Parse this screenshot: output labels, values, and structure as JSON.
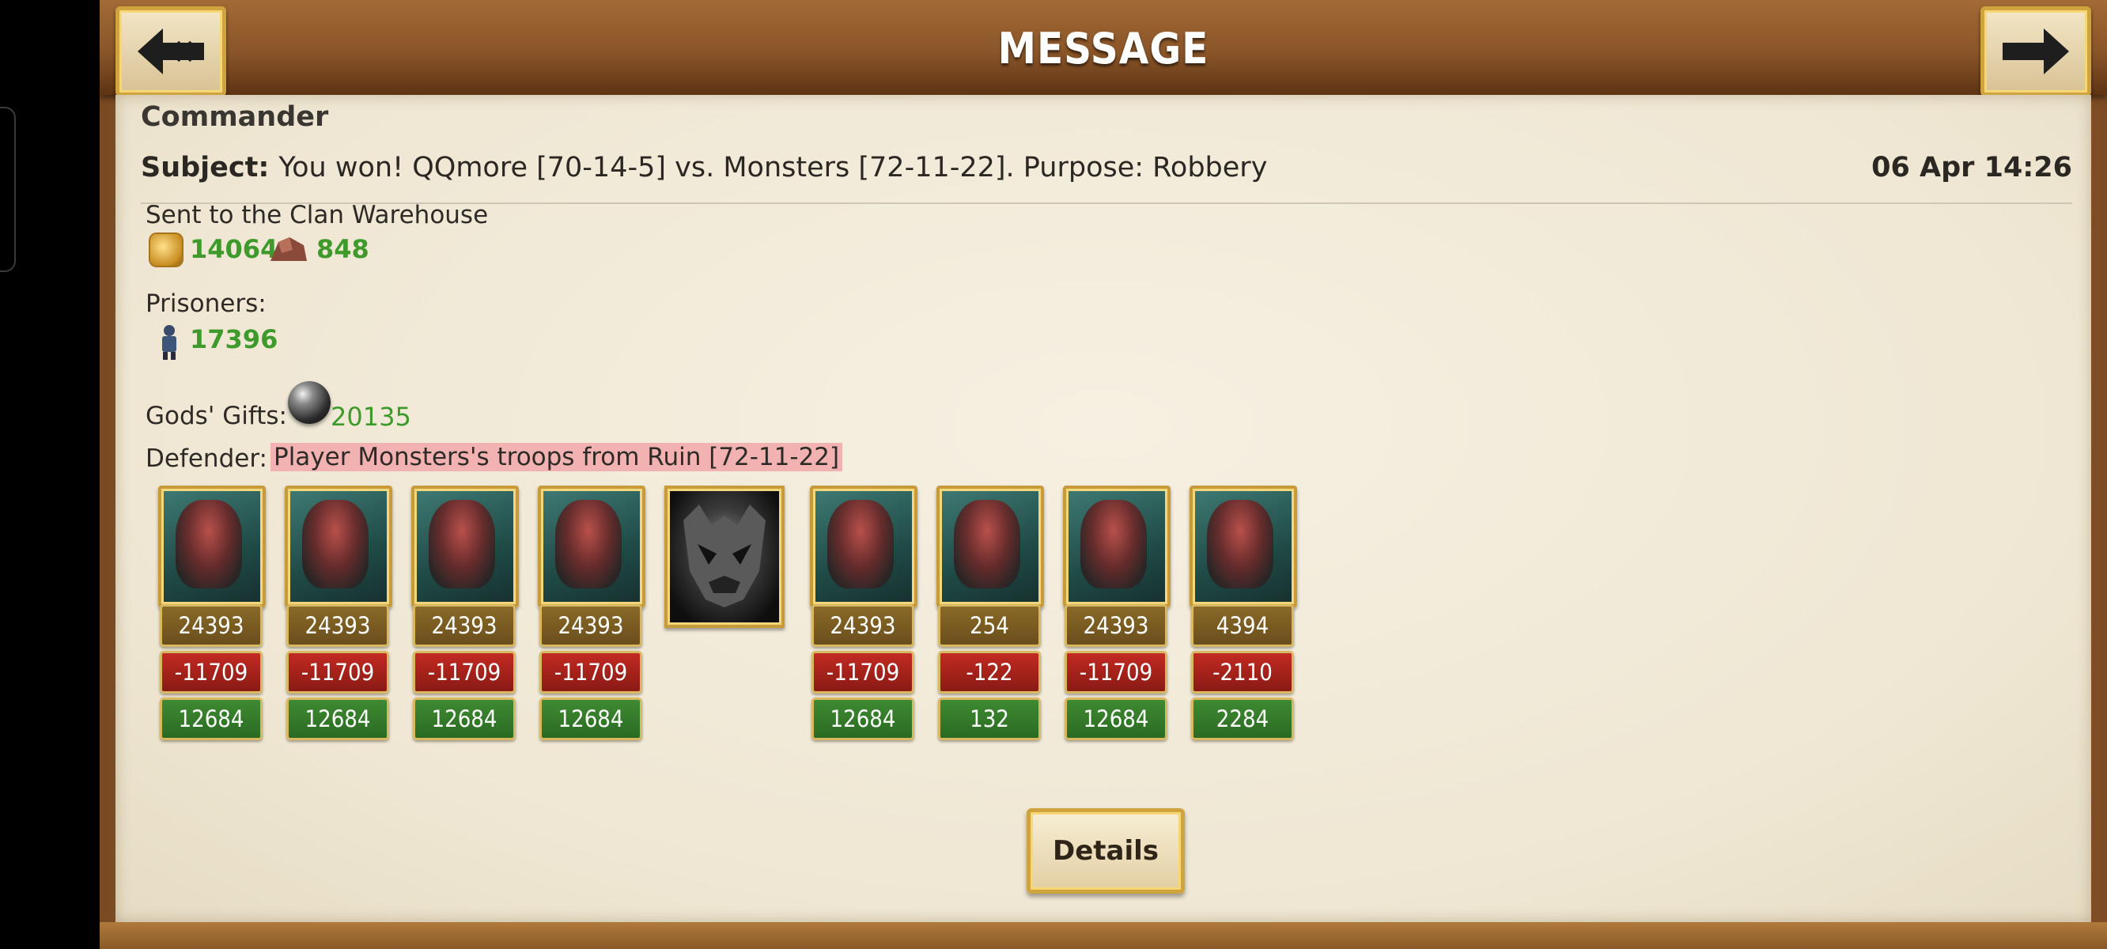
{
  "header": {
    "title": "MESSAGE",
    "back_icon": "triple-chevron-back-arrow-icon",
    "forward_icon": "arrow-right-icon"
  },
  "message": {
    "sender": "Commander",
    "subject_label": "Subject:",
    "subject_text": "You won! QQmore [70-14-5] vs. Monsters [72-11-22]. Purpose: Robbery",
    "date": "06 Apr 14:26"
  },
  "warehouse": {
    "label": "Sent to the Clan Warehouse",
    "gold": "14064",
    "ore": "848"
  },
  "prisoners": {
    "label": "Prisoners:",
    "count": "17396"
  },
  "gods_gifts": {
    "label": "Gods' Gifts:",
    "value": "20135"
  },
  "defender": {
    "label": "Defender:",
    "text": "Player Monsters's troops from Ruin [72-11-22]"
  },
  "units": [
    {
      "name": "beast-monster",
      "total": "24393",
      "loss": "-11709",
      "remain": "12684"
    },
    {
      "name": "armored-giant",
      "total": "24393",
      "loss": "-11709",
      "remain": "12684"
    },
    {
      "name": "orc-warrior",
      "total": "24393",
      "loss": "-11709",
      "remain": "12684"
    },
    {
      "name": "red-winged-demon",
      "total": "24393",
      "loss": "-11709",
      "remain": "12684"
    },
    {
      "name": "spiked-beast",
      "total": "24393",
      "loss": "-11709",
      "remain": "12684"
    },
    {
      "name": "red-sorcerer",
      "total": "254",
      "loss": "-122",
      "remain": "132"
    },
    {
      "name": "axe-knight",
      "total": "24393",
      "loss": "-11709",
      "remain": "12684"
    },
    {
      "name": "serpent-mage",
      "total": "4394",
      "loss": "-2110",
      "remain": "2284"
    }
  ],
  "boss_icon": "demon-skull-boss-icon",
  "details_button": "Details",
  "colors": {
    "gain_green": "#3f9a2c",
    "loss_red": "#c22a22",
    "total_brown": "#7a5a22",
    "frame_gold": "#cfa43e"
  }
}
